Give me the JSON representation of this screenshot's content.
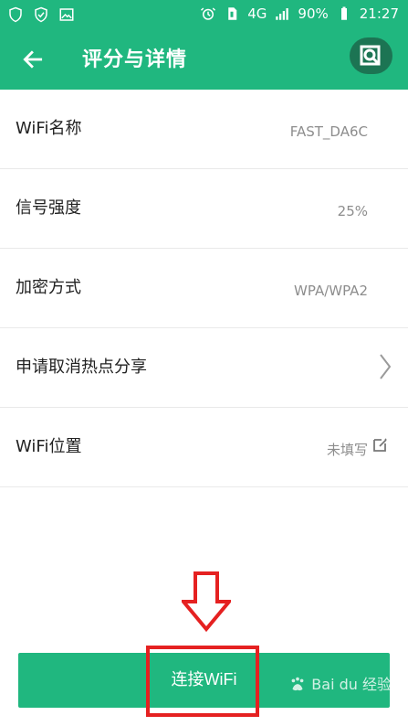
{
  "status_bar": {
    "battery": "90%",
    "time": "21:27",
    "network": "4G"
  },
  "header": {
    "title": "评分与详情"
  },
  "details": [
    {
      "label": "WiFi名称",
      "value": "FAST_DA6C"
    },
    {
      "label": "信号强度",
      "value": "25%"
    },
    {
      "label": "加密方式",
      "value": "WPA/WPA2"
    },
    {
      "label": "申请取消热点分享",
      "value": ""
    },
    {
      "label": "WiFi位置",
      "value": "未填写"
    }
  ],
  "actions": {
    "connect_label": "连接WiFi"
  },
  "watermark": {
    "text": "Bai  du 经验"
  },
  "colors": {
    "accent": "#20b77f",
    "text": "#222222",
    "muted": "#8d8d8d",
    "annotation": "#e52121"
  },
  "icons": {
    "back": "back-arrow-icon",
    "screenshot": "screenshot-icon",
    "chevron": "chevron-right-icon",
    "edit": "edit-icon",
    "annotation_arrow": "arrow-down-icon"
  }
}
